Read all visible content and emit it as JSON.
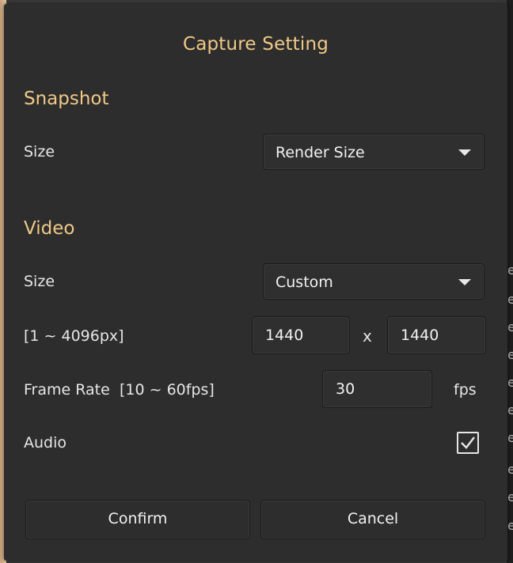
{
  "dialog": {
    "title": "Capture Setting"
  },
  "snapshot": {
    "heading": "Snapshot",
    "size_label": "Size",
    "size_value": "Render Size"
  },
  "video": {
    "heading": "Video",
    "size_label": "Size",
    "size_value": "Custom",
    "range_label": "[1 ~ 4096px]",
    "width_value": "1440",
    "separator": "x",
    "height_value": "1440",
    "frame_rate_label": "Frame Rate",
    "frame_rate_range": "[10 ~ 60fps]",
    "frame_rate_value": "30",
    "frame_rate_unit": "fps",
    "audio_label": "Audio",
    "audio_checked": true
  },
  "buttons": {
    "confirm": "Confirm",
    "cancel": "Cancel"
  },
  "background": {
    "peek_letters": [
      "e",
      "e",
      "e",
      "e",
      "e",
      "e",
      "e",
      "e",
      "e",
      "e"
    ]
  },
  "colors": {
    "accent": "#f0c987",
    "dialog_bg": "#2d2d2d",
    "text": "#e6e6e6"
  }
}
